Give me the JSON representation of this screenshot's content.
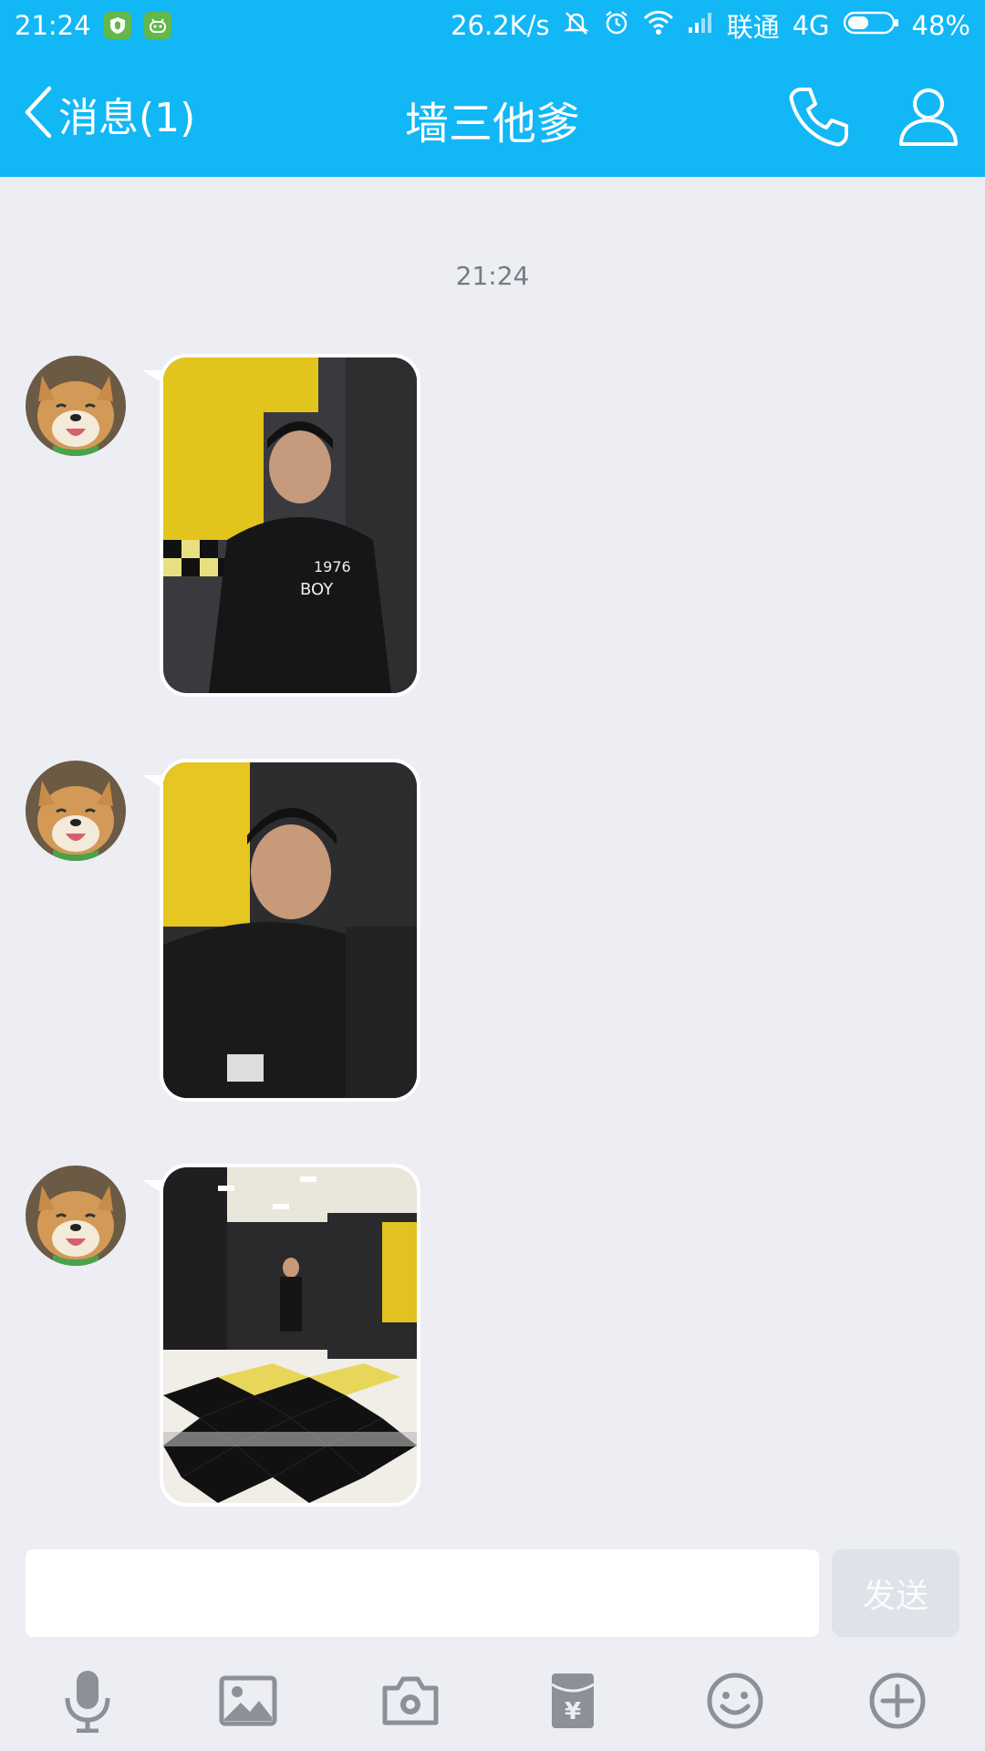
{
  "status_bar": {
    "time": "21:24",
    "net_speed": "26.2K/s",
    "carrier": "联通",
    "network_type": "4G",
    "battery": "48%",
    "battery_level": 0.48
  },
  "header": {
    "back_label": "消息(1)",
    "title": "墙三他爹"
  },
  "chat": {
    "timestamp": "21:24",
    "messages": [
      {
        "type": "image",
        "content": "photo of a boy in black jacket in yellow-black locker room"
      },
      {
        "type": "image",
        "content": "blurry close-up photo of the boy"
      },
      {
        "type": "image",
        "content": "wide photo of checkered floor room with the boy standing"
      }
    ]
  },
  "input": {
    "placeholder": "",
    "value": "",
    "send_label": "发送"
  },
  "toolbar": {
    "icons": [
      "microphone-icon",
      "picture-icon",
      "camera-icon",
      "red-packet-icon",
      "emoji-icon",
      "plus-icon"
    ]
  },
  "colors": {
    "accent": "#12b7f5",
    "background": "#eceef3",
    "send_disabled": "#dfe2e8"
  }
}
